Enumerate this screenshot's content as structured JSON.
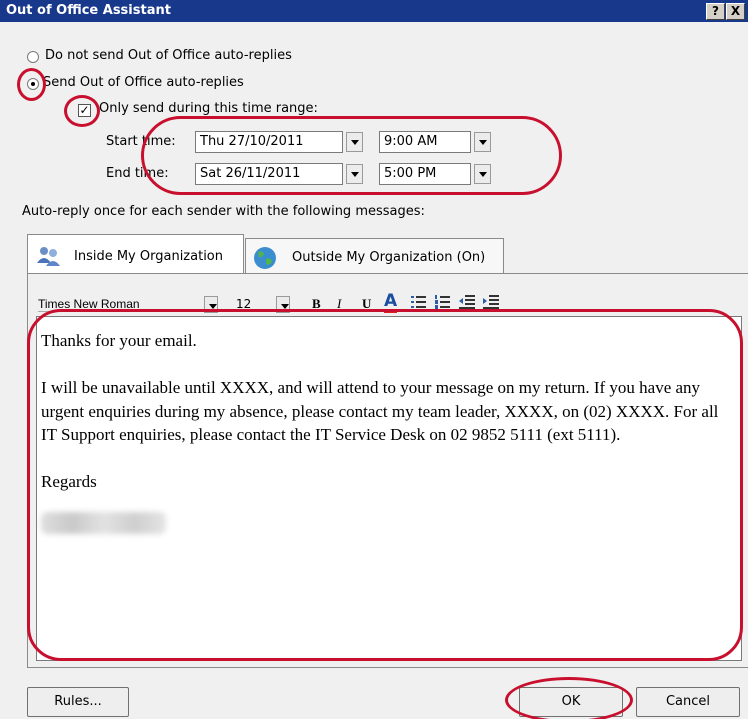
{
  "window": {
    "title": "Out of Office Assistant",
    "help_label": "?",
    "close_label": "X"
  },
  "options": {
    "do_not_send_label": "Do not send Out of Office auto-replies",
    "send_label": "Send Out of Office auto-replies",
    "time_range_label": "Only send during this time range:",
    "start_time_label": "Start time:",
    "end_time_label": "End time:",
    "start_date": "Thu 27/10/2011",
    "start_time": "9:00 AM",
    "end_date": "Sat 26/11/2011",
    "end_time": "5:00 PM",
    "send_selected": true,
    "time_range_checked": true
  },
  "autoreply_label": "Auto-reply once for each sender with the following messages:",
  "tabs": [
    {
      "label": "Inside My Organization",
      "icon": "users-icon",
      "active": true
    },
    {
      "label": "Outside My Organization (On)",
      "icon": "globe-icon",
      "active": false
    }
  ],
  "toolbar": {
    "font_name": "Times New Roman",
    "font_size": "12",
    "bold_label": "B",
    "italic_label": "I",
    "underline_label": "U",
    "font_color_label": "A",
    "font_color": "#e02020"
  },
  "message": {
    "line1": "Thanks for your email.",
    "line2": "I will be unavailable until XXXX, and will attend to your message on my return. If you have any urgent enquiries during my absence, please contact my team leader, XXXX, on (02) XXXX. For all IT Support enquiries, please contact the IT Service Desk on 02 9852 5111 (ext 5111).",
    "line3": "Regards"
  },
  "buttons": {
    "rules": "Rules...",
    "ok": "OK",
    "cancel": "Cancel"
  },
  "colors": {
    "titlebar": "#18388c",
    "highlight": "#c8102e"
  }
}
